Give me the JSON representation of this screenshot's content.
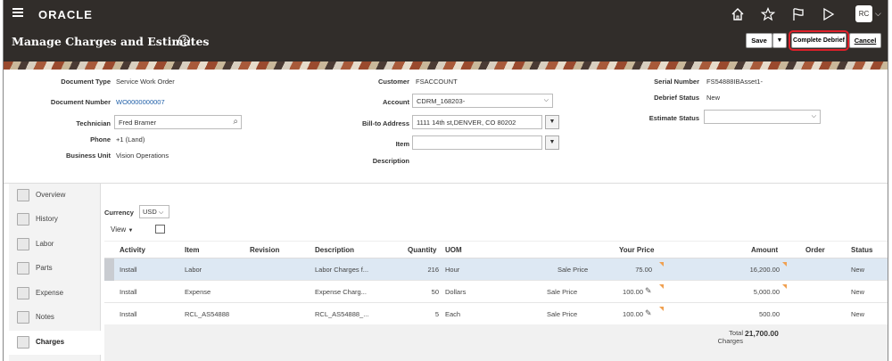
{
  "app": {
    "logo": "ORACLE",
    "avatar_initials": "RC"
  },
  "page": {
    "title": "Manage Charges and Estimates"
  },
  "toolbar": {
    "save": "Save",
    "complete_debrief": "Complete Debrief",
    "cancel": "Cancel"
  },
  "header": {
    "document_type": {
      "label": "Document Type",
      "value": "Service Work Order"
    },
    "document_number": {
      "label": "Document Number",
      "value": "WO0000000007"
    },
    "technician": {
      "label": "Technician",
      "value": "Fred Bramer"
    },
    "phone": {
      "label": "Phone",
      "value": "+1 (Land)"
    },
    "business_unit": {
      "label": "Business Unit",
      "value": "Vision Operations"
    },
    "customer": {
      "label": "Customer",
      "value": "FSACCOUNT"
    },
    "account": {
      "label": "Account",
      "value": "CDRM_168203-"
    },
    "bill_to": {
      "label": "Bill-to Address",
      "value": "1111 14th st,DENVER, CO 80202"
    },
    "item": {
      "label": "Item",
      "value": ""
    },
    "description": {
      "label": "Description",
      "value": ""
    },
    "serial_number": {
      "label": "Serial Number",
      "value": "FS54888IBAsset1-"
    },
    "debrief_status": {
      "label": "Debrief Status",
      "value": "New"
    },
    "estimate_status": {
      "label": "Estimate Status",
      "value": ""
    }
  },
  "sidenav": [
    {
      "label": "Overview"
    },
    {
      "label": "History"
    },
    {
      "label": "Labor"
    },
    {
      "label": "Parts"
    },
    {
      "label": "Expense"
    },
    {
      "label": "Notes"
    },
    {
      "label": "Charges"
    }
  ],
  "table": {
    "currency_label": "Currency",
    "currency_value": "USD",
    "view_label": "View",
    "columns": [
      "Activity",
      "Item",
      "Revision",
      "Description",
      "Quantity",
      "UOM",
      "Your Price",
      "Amount",
      "Order",
      "Status"
    ],
    "rows": [
      {
        "activity": "Install",
        "item": "Labor",
        "revision": "",
        "description": "Labor Charges f...",
        "quantity": "216",
        "uom": "Hour",
        "price_type": "Sale Price",
        "price": "75.00",
        "amount": "16,200.00",
        "order": "",
        "status": "New"
      },
      {
        "activity": "Install",
        "item": "Expense",
        "revision": "",
        "description": "Expense Charg...",
        "quantity": "50",
        "uom": "Dollars",
        "price_type": "Sale Price",
        "price": "100.00",
        "amount": "5,000.00",
        "order": "",
        "status": "New"
      },
      {
        "activity": "Install",
        "item": "RCL_AS54888",
        "revision": "",
        "description": "RCL_AS54888_...",
        "quantity": "5",
        "uom": "Each",
        "price_type": "Sale Price",
        "price": "100.00",
        "amount": "500.00",
        "order": "",
        "status": "New"
      }
    ],
    "total_label": "Total Charges",
    "total_value": "21,700.00"
  }
}
